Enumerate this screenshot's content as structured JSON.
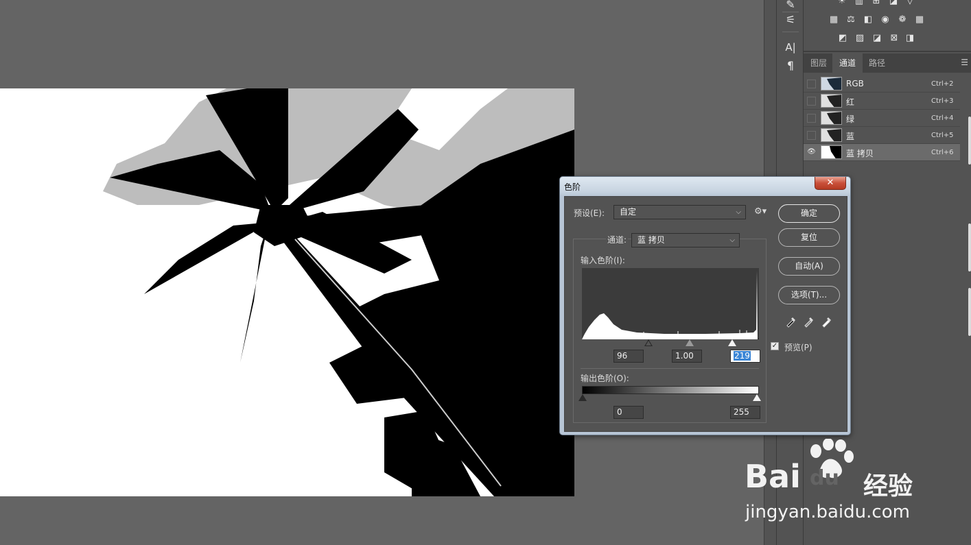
{
  "canvas": {
    "image_desc": "palm trees silhouette"
  },
  "tools": [
    {
      "name": "brush-icon",
      "glyph": "✎"
    },
    {
      "name": "adjust-sliders-icon",
      "glyph": "⚟"
    },
    {
      "name": "character-icon",
      "glyph": "A|"
    },
    {
      "name": "paragraph-icon",
      "glyph": "¶"
    }
  ],
  "channels_panel": {
    "tabs": [
      {
        "label": "图层",
        "active": false
      },
      {
        "label": "通道",
        "active": true
      },
      {
        "label": "路径",
        "active": false
      }
    ],
    "menu_icon": "☰",
    "channels": [
      {
        "name": "RGB",
        "shortcut": "Ctrl+2",
        "visible": false,
        "selected": false
      },
      {
        "name": "红",
        "shortcut": "Ctrl+3",
        "visible": false,
        "selected": false
      },
      {
        "name": "绿",
        "shortcut": "Ctrl+4",
        "visible": false,
        "selected": false
      },
      {
        "name": "蓝",
        "shortcut": "Ctrl+5",
        "visible": false,
        "selected": false
      },
      {
        "name": "蓝 拷贝",
        "shortcut": "Ctrl+6",
        "visible": true,
        "selected": true
      }
    ]
  },
  "levels_dialog": {
    "title": "色阶",
    "close_label": "✕",
    "preset_label": "预设(E):",
    "preset_value": "自定",
    "channel_label": "通道:",
    "channel_value": "蓝 拷贝",
    "input_label": "输入色阶(I):",
    "input_black": "96",
    "input_gamma": "1.00",
    "input_white": "219",
    "output_label": "输出色阶(O):",
    "output_black": "0",
    "output_white": "255",
    "buttons": {
      "ok": "确定",
      "reset": "复位",
      "auto": "自动(A)",
      "options": "选项(T)..."
    },
    "preview_label": "预览(P)",
    "preview_checked": true
  },
  "watermark": {
    "brand": "Bai",
    "brand2": "du",
    "cn": "经验",
    "url": "jingyan.baidu.com"
  }
}
